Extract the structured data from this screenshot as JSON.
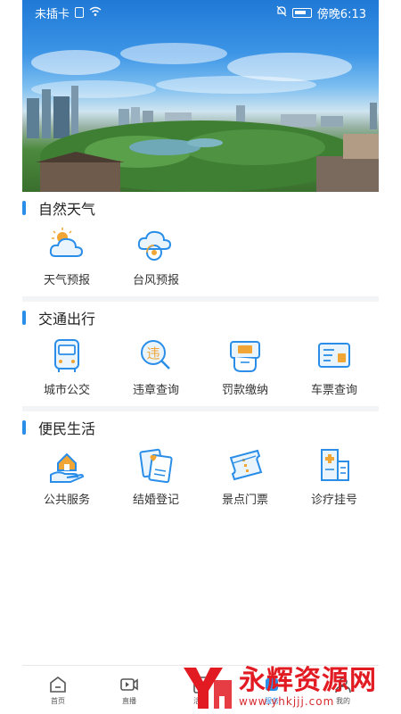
{
  "status_bar": {
    "carrier": "未插卡",
    "time": "傍晚6:13",
    "icons": [
      "sim-icon",
      "wifi-icon",
      "bell-off-icon",
      "battery-icon"
    ]
  },
  "hero": {
    "image": "city-skyline-park-lake"
  },
  "sections": [
    {
      "title": "自然天气",
      "items": [
        {
          "label": "天气预报",
          "icon": "weather-icon"
        },
        {
          "label": "台风预报",
          "icon": "typhoon-icon"
        }
      ]
    },
    {
      "title": "交通出行",
      "items": [
        {
          "label": "城市公交",
          "icon": "bus-icon"
        },
        {
          "label": "违章查询",
          "icon": "violation-icon"
        },
        {
          "label": "罚款缴纳",
          "icon": "fine-payment-icon"
        },
        {
          "label": "车票查询",
          "icon": "ticket-icon"
        }
      ]
    },
    {
      "title": "便民生活",
      "items": [
        {
          "label": "公共服务",
          "icon": "public-service-icon"
        },
        {
          "label": "结婚登记",
          "icon": "marriage-icon"
        },
        {
          "label": "景点门票",
          "icon": "scenic-ticket-icon"
        },
        {
          "label": "诊疗挂号",
          "icon": "hospital-icon"
        }
      ]
    }
  ],
  "bottom_nav": [
    {
      "label": "首页",
      "icon": "home-icon"
    },
    {
      "label": "直播",
      "icon": "live-video-icon"
    },
    {
      "label": "活动",
      "icon": "activity-icon"
    },
    {
      "label": "服务",
      "icon": "service-icon"
    },
    {
      "label": "我的",
      "icon": "profile-icon"
    }
  ],
  "watermark": {
    "name": "永辉资源网",
    "url": "www.yhkjjj.com"
  },
  "colors": {
    "accent": "#2a8ee8",
    "icon_orange": "#f0a534",
    "watermark_red": "#e21b23"
  }
}
